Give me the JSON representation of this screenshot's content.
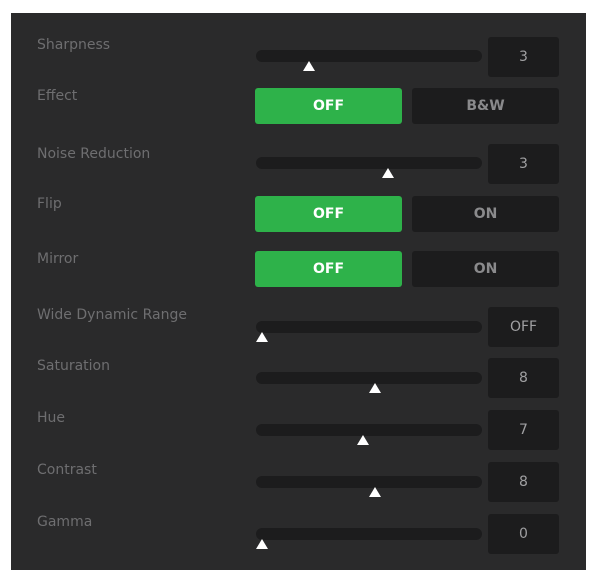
{
  "colors": {
    "panel_bg": "#2a2a2b",
    "control_bg": "#1c1c1d",
    "accent_green": "#2eb24a",
    "label_gray": "#6e6e70"
  },
  "settings": [
    {
      "id": "sharpness",
      "label": "Sharpness",
      "kind": "slider",
      "value": "3",
      "level": 0.22
    },
    {
      "id": "effect",
      "label": "Effect",
      "kind": "toggle",
      "options": [
        "OFF",
        "B&W"
      ],
      "selected": "OFF"
    },
    {
      "id": "noise-reduction",
      "label": "Noise Reduction",
      "kind": "slider",
      "value": "3",
      "level": 0.59
    },
    {
      "id": "flip",
      "label": "Flip",
      "kind": "toggle",
      "options": [
        "OFF",
        "ON"
      ],
      "selected": "OFF"
    },
    {
      "id": "mirror",
      "label": "Mirror",
      "kind": "toggle",
      "options": [
        "OFF",
        "ON"
      ],
      "selected": "OFF"
    },
    {
      "id": "wide-dynamic-range",
      "label": "Wide Dynamic Range",
      "kind": "slider",
      "value": "OFF",
      "level": 0.0
    },
    {
      "id": "saturation",
      "label": "Saturation",
      "kind": "slider",
      "value": "8",
      "level": 0.53
    },
    {
      "id": "hue",
      "label": "Hue",
      "kind": "slider",
      "value": "7",
      "level": 0.47
    },
    {
      "id": "contrast",
      "label": "Contrast",
      "kind": "slider",
      "value": "8",
      "level": 0.53
    },
    {
      "id": "gamma",
      "label": "Gamma",
      "kind": "slider",
      "value": "0",
      "level": 0.0
    }
  ]
}
